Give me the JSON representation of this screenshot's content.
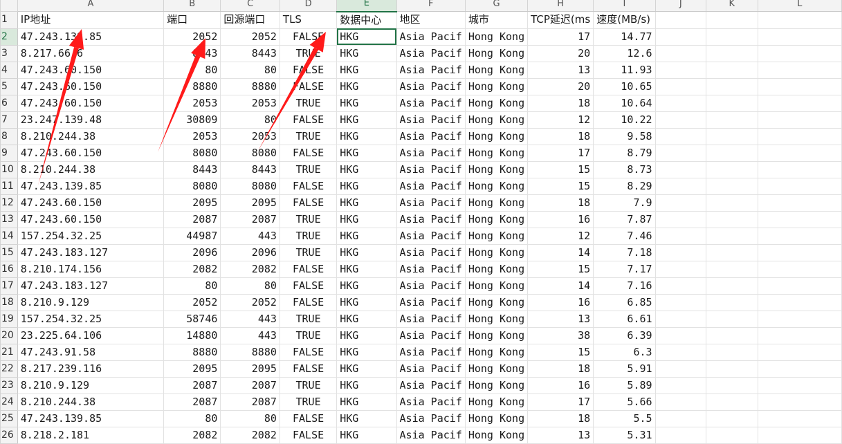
{
  "columns": [
    "",
    "A",
    "B",
    "C",
    "D",
    "E",
    "F",
    "G",
    "H",
    "I",
    "J",
    "K",
    "L"
  ],
  "headers": [
    "IP地址",
    "端口",
    "回源端口",
    "TLS",
    "数据中心",
    "地区",
    "城市",
    "TCP延迟(ms",
    "速度(MB/s)"
  ],
  "rows": [
    [
      "47.243.139.85",
      "2052",
      "2052",
      "FALSE",
      "HKG",
      "Asia Pacif",
      "Hong Kong",
      "17",
      "14.77"
    ],
    [
      "8.217.66.6",
      "8443",
      "8443",
      "TRUE",
      "HKG",
      "Asia Pacif",
      "Hong Kong",
      "20",
      "12.6"
    ],
    [
      "47.243.60.150",
      "80",
      "80",
      "FALSE",
      "HKG",
      "Asia Pacif",
      "Hong Kong",
      "13",
      "11.93"
    ],
    [
      "47.243.60.150",
      "8880",
      "8880",
      "FALSE",
      "HKG",
      "Asia Pacif",
      "Hong Kong",
      "20",
      "10.65"
    ],
    [
      "47.243.60.150",
      "2053",
      "2053",
      "TRUE",
      "HKG",
      "Asia Pacif",
      "Hong Kong",
      "18",
      "10.64"
    ],
    [
      "23.247.139.48",
      "30809",
      "80",
      "FALSE",
      "HKG",
      "Asia Pacif",
      "Hong Kong",
      "12",
      "10.22"
    ],
    [
      "8.210.244.38",
      "2053",
      "2053",
      "TRUE",
      "HKG",
      "Asia Pacif",
      "Hong Kong",
      "18",
      "9.58"
    ],
    [
      "47.243.60.150",
      "8080",
      "8080",
      "FALSE",
      "HKG",
      "Asia Pacif",
      "Hong Kong",
      "17",
      "8.79"
    ],
    [
      "8.210.244.38",
      "8443",
      "8443",
      "TRUE",
      "HKG",
      "Asia Pacif",
      "Hong Kong",
      "15",
      "8.73"
    ],
    [
      "47.243.139.85",
      "8080",
      "8080",
      "FALSE",
      "HKG",
      "Asia Pacif",
      "Hong Kong",
      "15",
      "8.29"
    ],
    [
      "47.243.60.150",
      "2095",
      "2095",
      "FALSE",
      "HKG",
      "Asia Pacif",
      "Hong Kong",
      "18",
      "7.9"
    ],
    [
      "47.243.60.150",
      "2087",
      "2087",
      "TRUE",
      "HKG",
      "Asia Pacif",
      "Hong Kong",
      "16",
      "7.87"
    ],
    [
      "157.254.32.25",
      "44987",
      "443",
      "TRUE",
      "HKG",
      "Asia Pacif",
      "Hong Kong",
      "12",
      "7.46"
    ],
    [
      "47.243.183.127",
      "2096",
      "2096",
      "TRUE",
      "HKG",
      "Asia Pacif",
      "Hong Kong",
      "14",
      "7.18"
    ],
    [
      "8.210.174.156",
      "2082",
      "2082",
      "FALSE",
      "HKG",
      "Asia Pacif",
      "Hong Kong",
      "15",
      "7.17"
    ],
    [
      "47.243.183.127",
      "80",
      "80",
      "FALSE",
      "HKG",
      "Asia Pacif",
      "Hong Kong",
      "14",
      "7.16"
    ],
    [
      "8.210.9.129",
      "2052",
      "2052",
      "FALSE",
      "HKG",
      "Asia Pacif",
      "Hong Kong",
      "16",
      "6.85"
    ],
    [
      "157.254.32.25",
      "58746",
      "443",
      "TRUE",
      "HKG",
      "Asia Pacif",
      "Hong Kong",
      "13",
      "6.61"
    ],
    [
      "23.225.64.106",
      "14880",
      "443",
      "TRUE",
      "HKG",
      "Asia Pacif",
      "Hong Kong",
      "38",
      "6.39"
    ],
    [
      "47.243.91.58",
      "8880",
      "8880",
      "FALSE",
      "HKG",
      "Asia Pacif",
      "Hong Kong",
      "15",
      "6.3"
    ],
    [
      "8.217.239.116",
      "2095",
      "2095",
      "FALSE",
      "HKG",
      "Asia Pacif",
      "Hong Kong",
      "18",
      "5.91"
    ],
    [
      "8.210.9.129",
      "2087",
      "2087",
      "TRUE",
      "HKG",
      "Asia Pacif",
      "Hong Kong",
      "16",
      "5.89"
    ],
    [
      "8.210.244.38",
      "2087",
      "2087",
      "TRUE",
      "HKG",
      "Asia Pacif",
      "Hong Kong",
      "17",
      "5.66"
    ],
    [
      "47.243.139.85",
      "80",
      "80",
      "FALSE",
      "HKG",
      "Asia Pacif",
      "Hong Kong",
      "18",
      "5.5"
    ],
    [
      "8.218.2.181",
      "2082",
      "2082",
      "FALSE",
      "HKG",
      "Asia Pacif",
      "Hong Kong",
      "13",
      "5.31"
    ]
  ],
  "selected_cell": "E2",
  "annotation": {
    "arrow_color": "#ff1a1a",
    "arrow_count": 3
  }
}
